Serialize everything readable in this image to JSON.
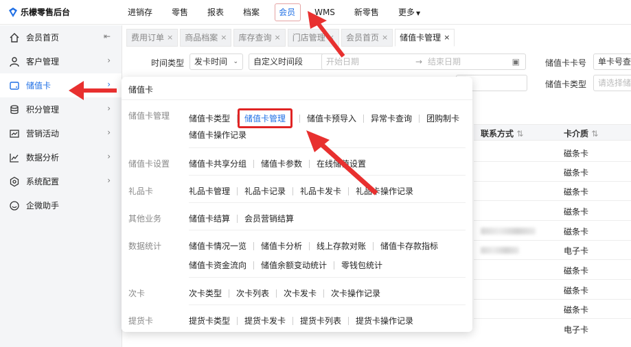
{
  "app": {
    "title": "乐檬零售后台"
  },
  "topnav": [
    {
      "label": "进销存"
    },
    {
      "label": "零售"
    },
    {
      "label": "报表"
    },
    {
      "label": "档案"
    },
    {
      "label": "会员",
      "active": true
    },
    {
      "label": "WMS"
    },
    {
      "label": "新零售"
    },
    {
      "label": "更多"
    }
  ],
  "sidebar": {
    "items": [
      {
        "label": "会员首页",
        "icon": "home-icon"
      },
      {
        "label": "客户管理",
        "icon": "user-icon"
      },
      {
        "label": "储值卡",
        "icon": "card-icon",
        "active": true
      },
      {
        "label": "积分管理",
        "icon": "database-icon"
      },
      {
        "label": "营销活动",
        "icon": "activity-icon"
      },
      {
        "label": "数据分析",
        "icon": "chart-line-icon"
      },
      {
        "label": "系统配置",
        "icon": "settings-icon"
      },
      {
        "label": "企微助手",
        "icon": "chat-icon"
      }
    ]
  },
  "tabs": [
    {
      "label": "费用订单"
    },
    {
      "label": "商品档案"
    },
    {
      "label": "库存查询"
    },
    {
      "label": "门店管理"
    },
    {
      "label": "会员首页"
    },
    {
      "label": "储值卡管理",
      "active": true
    }
  ],
  "filters": {
    "time_type_label": "时间类型",
    "time_type_value": "发卡时间",
    "range_value": "自定义时间段",
    "start_placeholder": "开始日期",
    "end_placeholder": "结束日期",
    "card_no_label": "储值卡卡号",
    "card_no_value": "单卡号查",
    "card_type_label": "储值卡类型",
    "card_type_placeholder": "请选择储"
  },
  "table": {
    "headers": [
      "联系方式",
      "卡介质"
    ],
    "rows": [
      "磁条卡",
      "磁条卡",
      "磁条卡",
      "磁条卡",
      "磁条卡",
      "电子卡",
      "磁条卡",
      "磁条卡",
      "磁条卡",
      "电子卡"
    ]
  },
  "panel": {
    "title": "储值卡",
    "groups": [
      {
        "label": "储值卡管理",
        "rows": [
          [
            "储值卡类型",
            "储值卡管理",
            "储值卡预导入",
            "异常卡查询",
            "团购制卡"
          ],
          [
            "储值卡操作记录"
          ]
        ]
      },
      {
        "label": "储值卡设置",
        "rows": [
          [
            "储值卡共享分组",
            "储值卡参数",
            "在线储值设置"
          ]
        ]
      },
      {
        "label": "礼品卡",
        "rows": [
          [
            "礼品卡管理",
            "礼品卡记录",
            "礼品卡发卡",
            "礼品卡操作记录"
          ]
        ]
      },
      {
        "label": "其他业务",
        "rows": [
          [
            "储值卡结算",
            "会员营销结算"
          ]
        ]
      },
      {
        "label": "数据统计",
        "rows": [
          [
            "储值卡情况一览",
            "储值卡分析",
            "线上存款对账",
            "储值卡存款指标"
          ],
          [
            "储值卡资金流向",
            "储值余额变动统计",
            "零钱包统计"
          ]
        ]
      },
      {
        "label": "次卡",
        "rows": [
          [
            "次卡类型",
            "次卡列表",
            "次卡发卡",
            "次卡操作记录"
          ]
        ]
      },
      {
        "label": "提货卡",
        "rows": [
          [
            "提货卡类型",
            "提货卡发卡",
            "提货卡列表",
            "提货卡操作记录"
          ]
        ]
      }
    ],
    "selected": "储值卡管理"
  },
  "colors": {
    "accent": "#1f6fe5",
    "highlight": "#e02424",
    "arrow": "#e8302f"
  }
}
